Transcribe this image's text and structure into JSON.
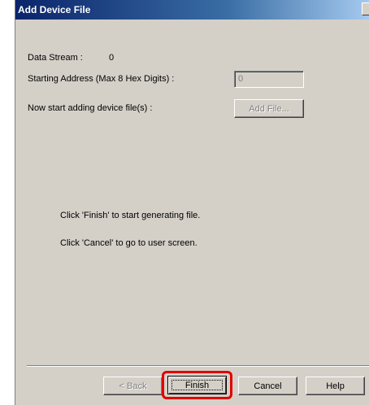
{
  "window": {
    "title": "Add Device File"
  },
  "form": {
    "data_stream_label": "Data Stream :",
    "data_stream_value": "0",
    "start_address_label": "Starting Address (Max 8 Hex Digits) :",
    "start_address_value": "0",
    "add_files_label": "Now start adding device file(s) :",
    "add_file_button": "Add File..."
  },
  "instructions": {
    "finish_hint": "Click 'Finish' to start generating file.",
    "cancel_hint": "Click 'Cancel' to go to user screen."
  },
  "buttons": {
    "back": "< Back",
    "finish": "Finish",
    "cancel": "Cancel",
    "help": "Help"
  },
  "annotation": {
    "highlight_color": "#e00000"
  }
}
